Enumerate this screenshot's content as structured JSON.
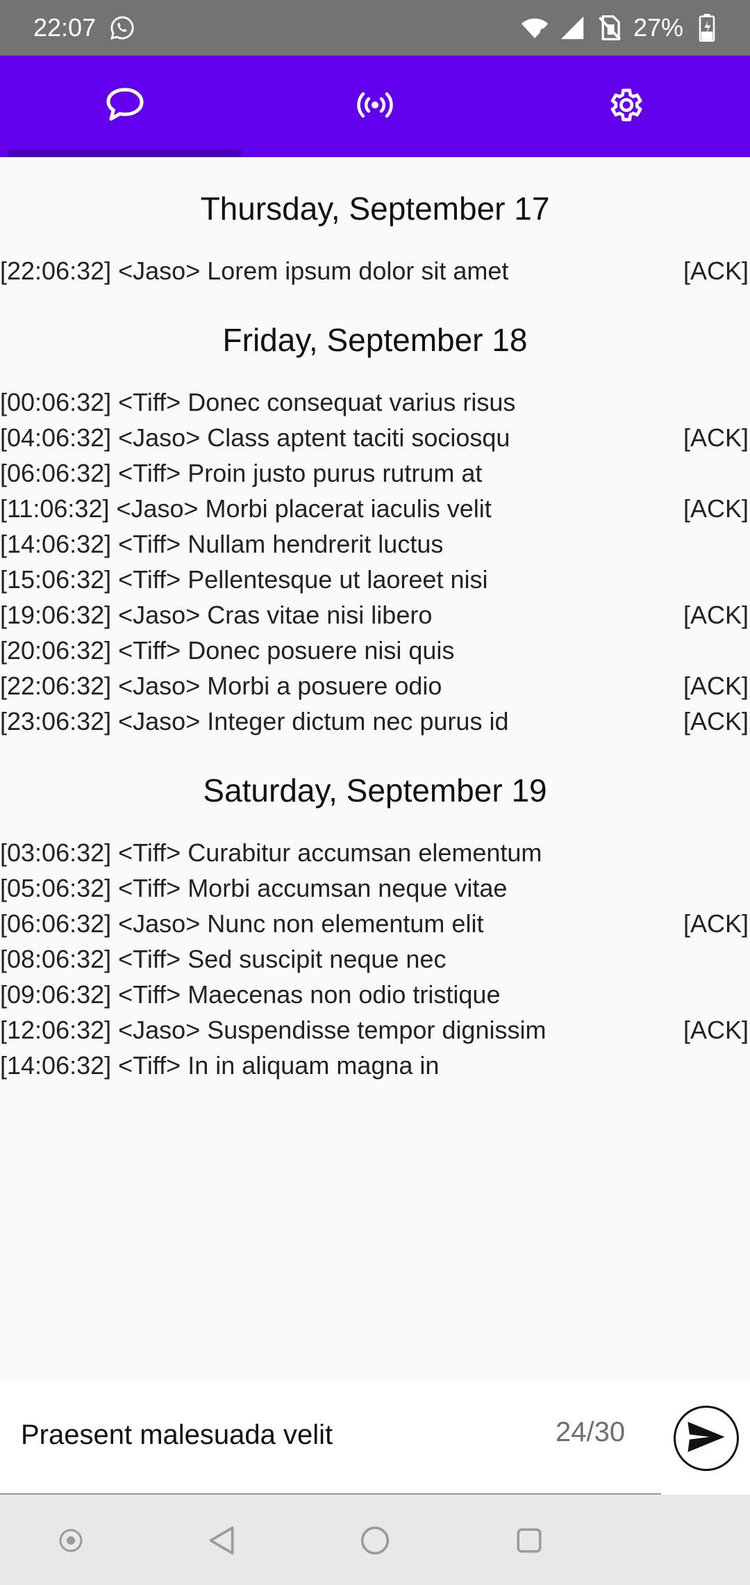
{
  "status_bar": {
    "time": "22:07",
    "battery": "27%",
    "icons": [
      "whatsapp-icon",
      "wifi-icon",
      "cell-signal-icon",
      "no-sim-icon",
      "battery-charging-icon"
    ]
  },
  "tabs": [
    {
      "name": "chat",
      "icon": "chat-bubble-icon",
      "selected": true
    },
    {
      "name": "broadcast",
      "icon": "broadcast-icon",
      "selected": false
    },
    {
      "name": "settings",
      "icon": "gear-icon",
      "selected": false
    }
  ],
  "chat": {
    "days": [
      {
        "date": "Thursday, September 17",
        "messages": [
          {
            "text": "[22:06:32] <Jaso> Lorem ipsum dolor sit amet",
            "ack": "[ACK]"
          }
        ]
      },
      {
        "date": "Friday, September 18",
        "messages": [
          {
            "text": "[00:06:32] <Tiff> Donec consequat varius risus",
            "ack": ""
          },
          {
            "text": "[04:06:32] <Jaso> Class aptent taciti sociosqu",
            "ack": "[ACK]"
          },
          {
            "text": "[06:06:32] <Tiff> Proin justo purus rutrum at",
            "ack": ""
          },
          {
            "text": "[11:06:32] <Jaso> Morbi placerat iaculis velit",
            "ack": "[ACK]"
          },
          {
            "text": "[14:06:32] <Tiff> Nullam hendrerit luctus",
            "ack": ""
          },
          {
            "text": "[15:06:32] <Tiff> Pellentesque ut laoreet nisi",
            "ack": ""
          },
          {
            "text": "[19:06:32] <Jaso> Cras vitae nisi libero",
            "ack": "[ACK]"
          },
          {
            "text": "[20:06:32] <Tiff> Donec posuere nisi quis",
            "ack": ""
          },
          {
            "text": "[22:06:32] <Jaso> Morbi a posuere odio",
            "ack": "[ACK]"
          },
          {
            "text": "[23:06:32] <Jaso> Integer dictum nec purus id",
            "ack": "[ACK]"
          }
        ]
      },
      {
        "date": "Saturday, September 19",
        "messages": [
          {
            "text": "[03:06:32] <Tiff> Curabitur accumsan elementum",
            "ack": ""
          },
          {
            "text": "[05:06:32] <Tiff> Morbi accumsan neque vitae",
            "ack": ""
          },
          {
            "text": "[06:06:32] <Jaso> Nunc non elementum elit",
            "ack": "[ACK]"
          },
          {
            "text": "[08:06:32] <Tiff> Sed suscipit neque nec",
            "ack": ""
          },
          {
            "text": "[09:06:32] <Tiff> Maecenas non odio tristique",
            "ack": ""
          },
          {
            "text": "[12:06:32] <Jaso> Suspendisse tempor dignissim",
            "ack": "[ACK]"
          },
          {
            "text": "[14:06:32] <Tiff> In in aliquam magna in",
            "ack": ""
          }
        ]
      }
    ]
  },
  "composer": {
    "value": "Praesent malesuada velit",
    "counter": "24/30",
    "send_icon": "send-icon"
  },
  "nav_bar": {
    "buttons": [
      "assistant-icon",
      "back-icon",
      "home-icon",
      "recents-icon"
    ]
  },
  "colors": {
    "accent": "#6200ee",
    "status_bar": "#737373",
    "background": "#fafafa"
  }
}
